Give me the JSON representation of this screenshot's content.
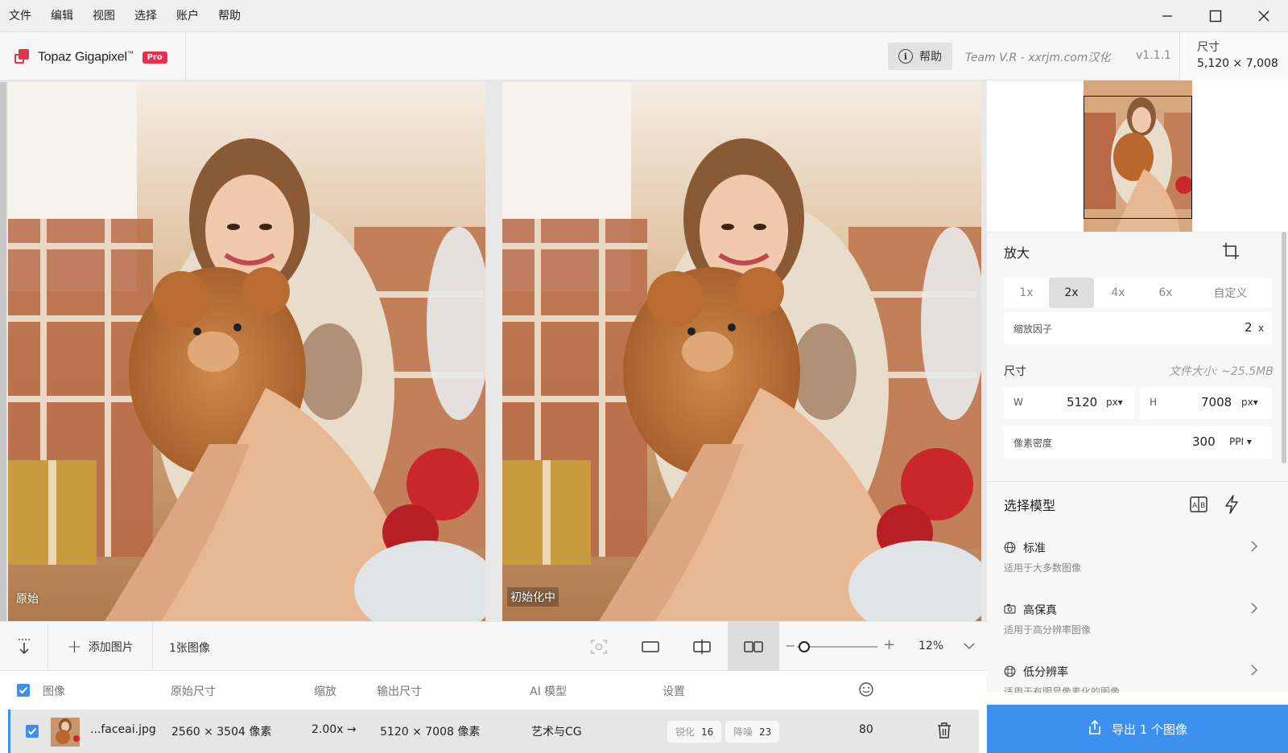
{
  "menu": [
    "文件",
    "编辑",
    "视图",
    "选择",
    "账户",
    "帮助"
  ],
  "header": {
    "app_name": "Topaz Gigapixel",
    "trademark": "™",
    "badge": "Pro",
    "help_label": "帮助",
    "team_text": "Team V.R - xxrjm.com汉化",
    "version": "v1.1.1",
    "size_label": "尺寸",
    "size_value": "5,120 × 7,008"
  },
  "preview": {
    "left_label": "原始",
    "right_label": "初始化中"
  },
  "toolbar": {
    "add_label": "添加图片",
    "count_label": "1张图像",
    "zoom_value": "12%",
    "zoom_minus": "−",
    "zoom_plus": "+",
    "view_mode": "side-by-side"
  },
  "list": {
    "headers": [
      "图像",
      "原始尺寸",
      "缩放",
      "输出尺寸",
      "AI 模型",
      "设置"
    ],
    "rows": [
      {
        "name": "...faceai.jpg",
        "original": "2560 × 3504 像素",
        "scale": "2.00x →",
        "output": "5120 × 7008 像素",
        "model": "艺术与CG",
        "sharpen_label": "锐化",
        "sharpen": "16",
        "denoise_label": "降噪",
        "denoise": "23",
        "face": "80"
      }
    ]
  },
  "enlarge": {
    "title": "放大",
    "scales": [
      "1x",
      "2x",
      "4x",
      "6x",
      "自定义"
    ],
    "active_scale": "2x",
    "factor_label": "缩放因子",
    "factor_value": "2",
    "factor_unit": "x",
    "dim_label": "尺寸",
    "file_size": "文件大小: ~25.5MB",
    "w_label": "W",
    "w_value": "5120",
    "w_unit": "px▾",
    "h_label": "H",
    "h_value": "7008",
    "h_unit": "px▾",
    "ppi_label": "像素密度",
    "ppi_value": "300",
    "ppi_unit": "PPI ▾"
  },
  "model": {
    "title": "选择模型",
    "items": [
      {
        "name": "标准",
        "desc": "适用于大多数图像",
        "icon": "globe-icon"
      },
      {
        "name": "高保真",
        "desc": "适用于高分辨率图像",
        "icon": "camera-icon"
      },
      {
        "name": "低分辨率",
        "desc": "适用于有明显像素化的图像",
        "icon": "grid-globe-icon"
      }
    ]
  },
  "export": {
    "label": "导出 1 个图像"
  },
  "colors": {
    "accent": "#3d8ff0",
    "brand": "#e8304f"
  }
}
